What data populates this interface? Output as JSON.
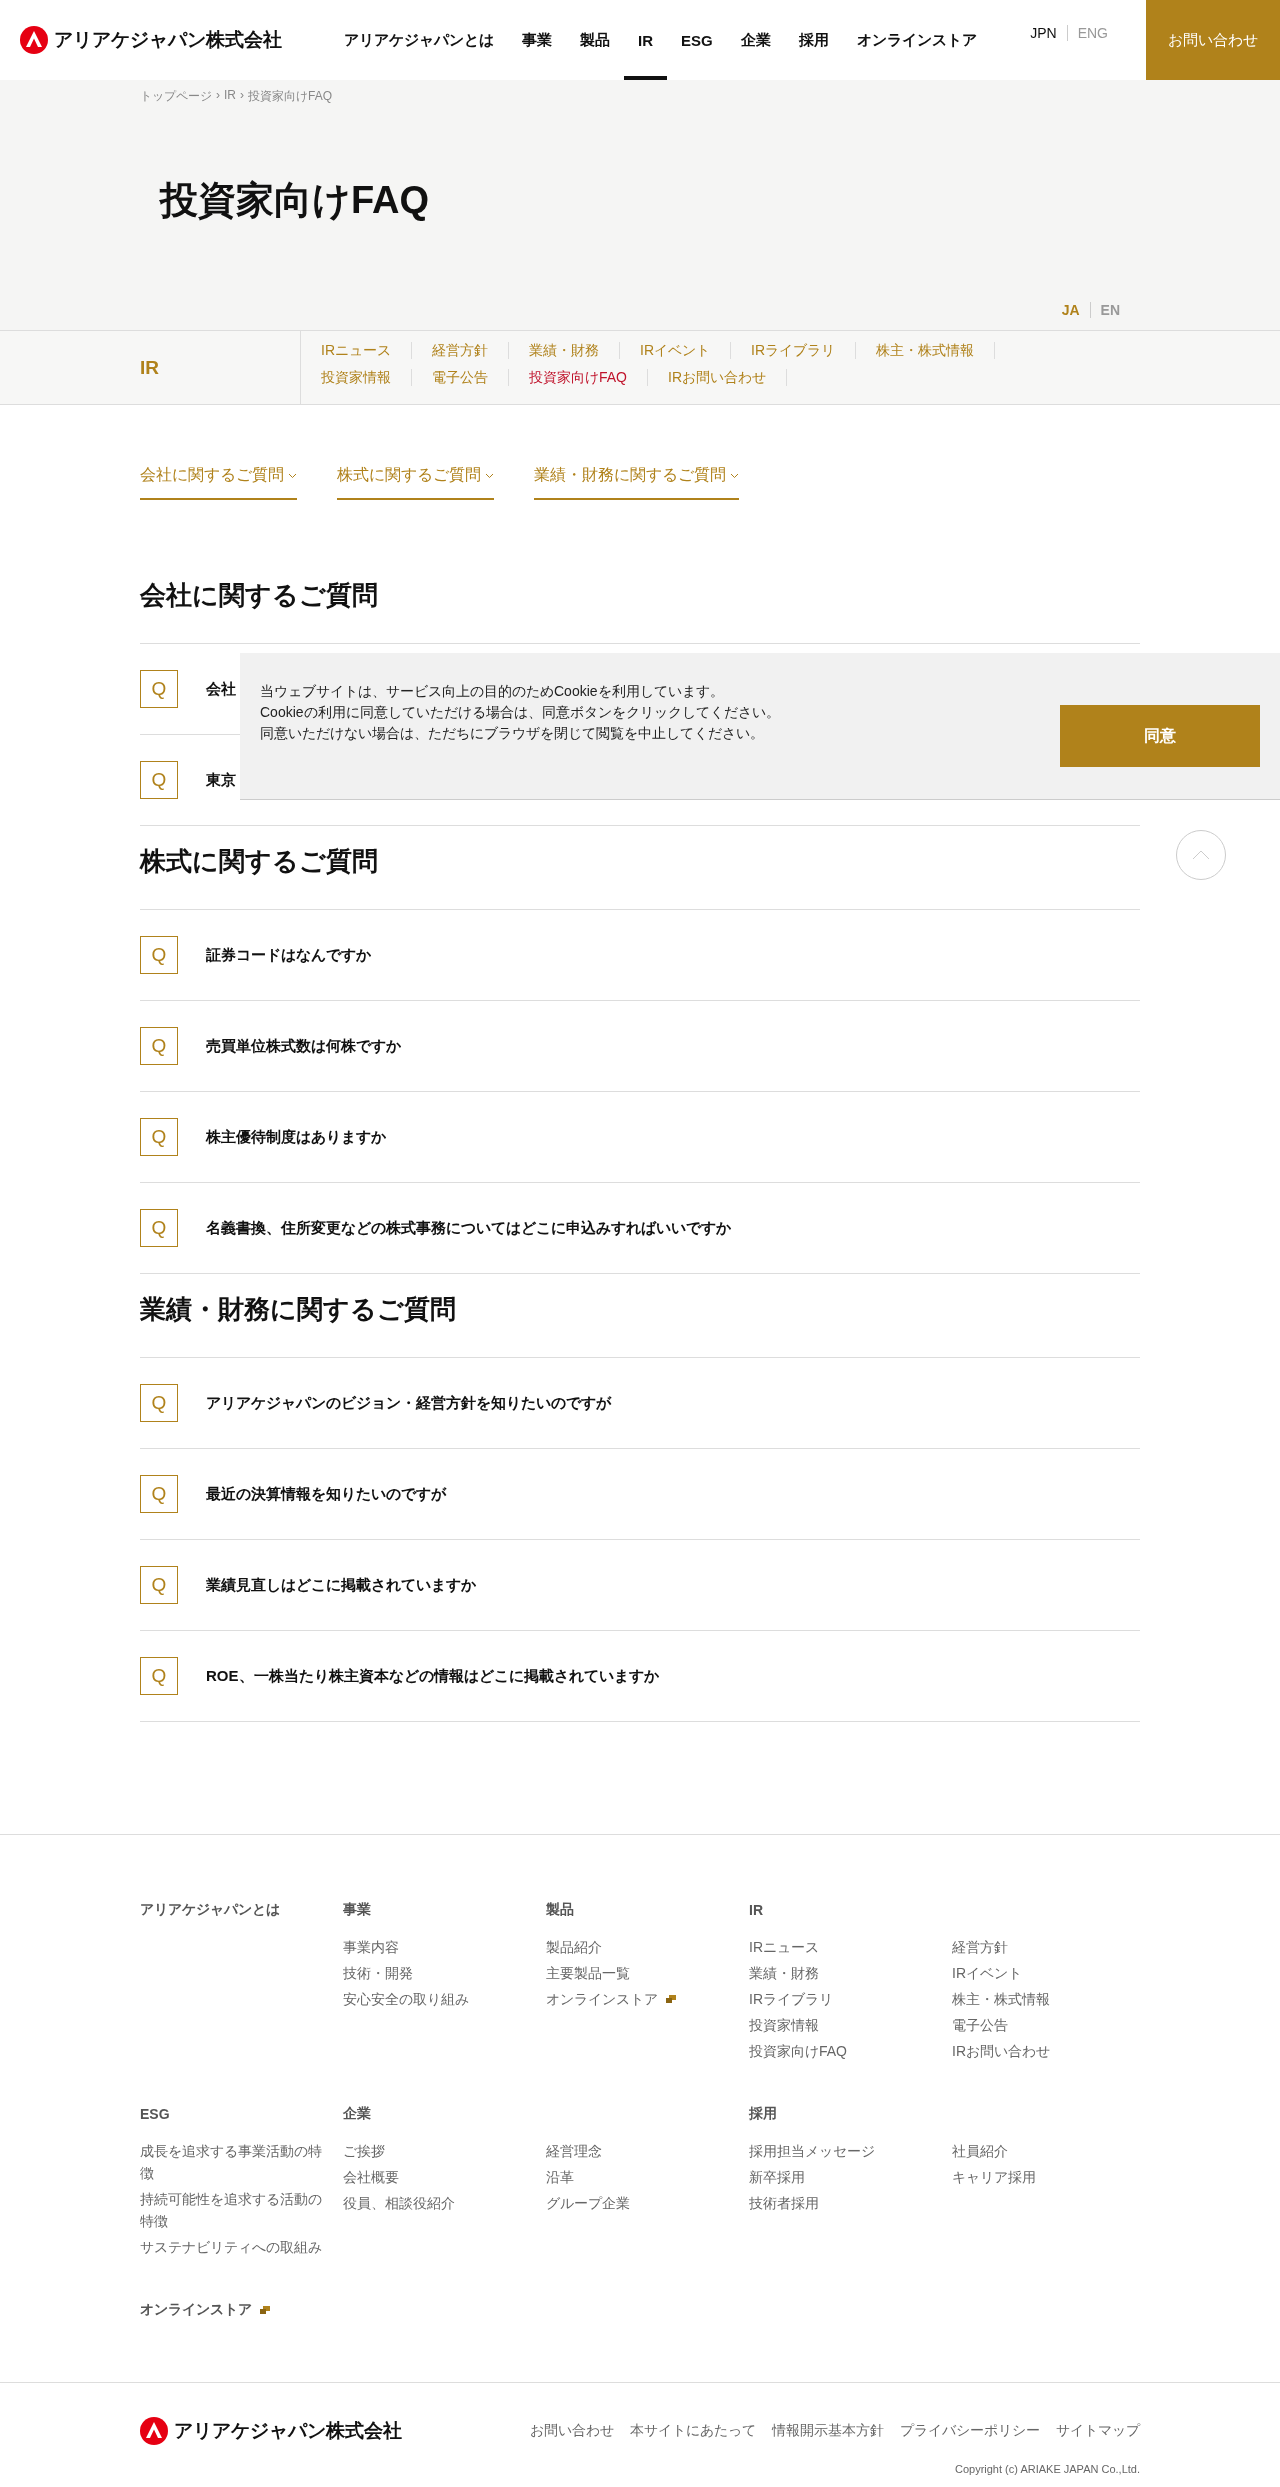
{
  "header": {
    "logo_text": "アリアケジャパン株式会社",
    "nav": [
      {
        "label": "アリアケジャパンとは",
        "selected": false
      },
      {
        "label": "事業",
        "selected": false
      },
      {
        "label": "製品",
        "selected": false
      },
      {
        "label": "IR",
        "selected": true
      },
      {
        "label": "ESG",
        "selected": false
      },
      {
        "label": "企業",
        "selected": false
      },
      {
        "label": "採用",
        "selected": false
      },
      {
        "label": "オンラインストア",
        "selected": false
      }
    ],
    "lang": [
      {
        "label": "JPN",
        "selected": true
      },
      {
        "label": "ENG",
        "selected": false
      }
    ],
    "contact_button": "お問い合わせ"
  },
  "breadcrumb": {
    "separator": "›",
    "items": [
      "トップページ",
      "IR",
      "投資家向けFAQ"
    ]
  },
  "hero": {
    "title": "投資家向けFAQ",
    "lang": [
      {
        "label": "JA",
        "selected": true
      },
      {
        "label": "EN",
        "selected": false
      }
    ]
  },
  "subnav": {
    "title": "IR",
    "rows": [
      [
        {
          "label": "IRニュース",
          "selected": false
        },
        {
          "label": "経営方針",
          "selected": false
        },
        {
          "label": "業績・財務",
          "selected": false
        },
        {
          "label": "IRイベント",
          "selected": false
        },
        {
          "label": "IRライブラリ",
          "selected": false
        },
        {
          "label": "株主・株式情報",
          "selected": false
        }
      ],
      [
        {
          "label": "投資家情報",
          "selected": false
        },
        {
          "label": "電子公告",
          "selected": false
        },
        {
          "label": "投資家向けFAQ",
          "selected": true
        },
        {
          "label": "IRお問い合わせ",
          "selected": false
        }
      ]
    ]
  },
  "anchors": [
    "会社に関するご質問",
    "株式に関するご質問",
    "業績・財務に関するご質問"
  ],
  "sections": [
    {
      "heading": "会社に関するご質問",
      "questions": [
        {
          "mark": "Q",
          "text": "会社"
        },
        {
          "mark": "Q",
          "text": "東京"
        }
      ]
    },
    {
      "heading": "株式に関するご質問",
      "questions": [
        {
          "mark": "Q",
          "text": "証券コードはなんですか"
        },
        {
          "mark": "Q",
          "text": "売買単位株式数は何株ですか"
        },
        {
          "mark": "Q",
          "text": "株主優待制度はありますか"
        },
        {
          "mark": "Q",
          "text": "名義書換、住所変更などの株式事務についてはどこに申込みすればいいですか"
        }
      ]
    },
    {
      "heading": "業績・財務に関するご質問",
      "questions": [
        {
          "mark": "Q",
          "text": "アリアケジャパンのビジョン・経営方針を知りたいのですが"
        },
        {
          "mark": "Q",
          "text": "最近の決算情報を知りたいのですが"
        },
        {
          "mark": "Q",
          "text": "業績見直しはどこに掲載されていますか"
        },
        {
          "mark": "Q",
          "text": "ROE、一株当たり株主資本などの情報はどこに掲載されていますか"
        }
      ]
    }
  ],
  "cookie": {
    "lines": [
      "当ウェブサイトは、サービス向上の目的のためCookieを利用しています。",
      "Cookieの利用に同意していただける場合は、同意ボタンをクリックしてください。",
      "同意いただけない場合は、ただちにブラウザを閉じて閲覧を中止してください。"
    ],
    "button": "同意"
  },
  "footer": {
    "rows": [
      [
        {
          "heading": "アリアケジャパンとは"
        },
        {
          "heading": "事業",
          "links": [
            {
              "label": "事業内容",
              "external": false
            },
            {
              "label": "技術・開発",
              "external": false
            },
            {
              "label": "安心安全の取り組み",
              "external": false
            }
          ]
        },
        {
          "heading": "製品",
          "links": [
            {
              "label": "製品紹介",
              "external": false
            },
            {
              "label": "主要製品一覧",
              "external": false
            },
            {
              "label": "オンラインストア",
              "external": true
            }
          ]
        },
        {
          "heading": "IR",
          "links": [
            {
              "label": "IRニュース",
              "external": false
            },
            {
              "label": "業績・財務",
              "external": false
            },
            {
              "label": "IRライブラリ",
              "external": false
            },
            {
              "label": "投資家情報",
              "external": false
            },
            {
              "label": "投資家向けFAQ",
              "external": false
            }
          ]
        },
        {
          "links": [
            {
              "label": "経営方針",
              "external": false
            },
            {
              "label": "IRイベント",
              "external": false
            },
            {
              "label": "株主・株式情報",
              "external": false
            },
            {
              "label": "電子公告",
              "external": false
            },
            {
              "label": "IRお問い合わせ",
              "external": false
            }
          ]
        }
      ],
      [
        {
          "heading": "ESG",
          "links": [
            {
              "label": "成長を追求する事業活動の特徴",
              "external": false
            },
            {
              "label": "持続可能性を追求する活動の特徴",
              "external": false
            },
            {
              "label": "サステナビリティへの取組み",
              "external": false
            }
          ]
        },
        {
          "heading": "企業",
          "links": [
            {
              "label": "ご挨拶",
              "external": false
            },
            {
              "label": "会社概要",
              "external": false
            },
            {
              "label": "役員、相談役紹介",
              "external": false
            }
          ]
        },
        {
          "links": [
            {
              "label": "経営理念",
              "external": false
            },
            {
              "label": "沿革",
              "external": false
            },
            {
              "label": "グループ企業",
              "external": false
            }
          ]
        },
        {
          "heading": "採用",
          "links": [
            {
              "label": "採用担当メッセージ",
              "external": false
            },
            {
              "label": "新卒採用",
              "external": false
            },
            {
              "label": "技術者採用",
              "external": false
            }
          ]
        },
        {
          "links": [
            {
              "label": "社員紹介",
              "external": false
            },
            {
              "label": "キャリア採用",
              "external": false
            }
          ]
        }
      ],
      [
        {
          "heading": "オンラインストア",
          "external": true
        }
      ]
    ],
    "logo_text": "アリアケジャパン株式会社",
    "bottom_links": [
      "お問い合わせ",
      "本サイトにあたって",
      "情報開示基本方針",
      "プライバシーポリシー",
      "サイトマップ"
    ],
    "copyright": "Copyright (c) ARIAKE JAPAN Co.,Ltd."
  }
}
